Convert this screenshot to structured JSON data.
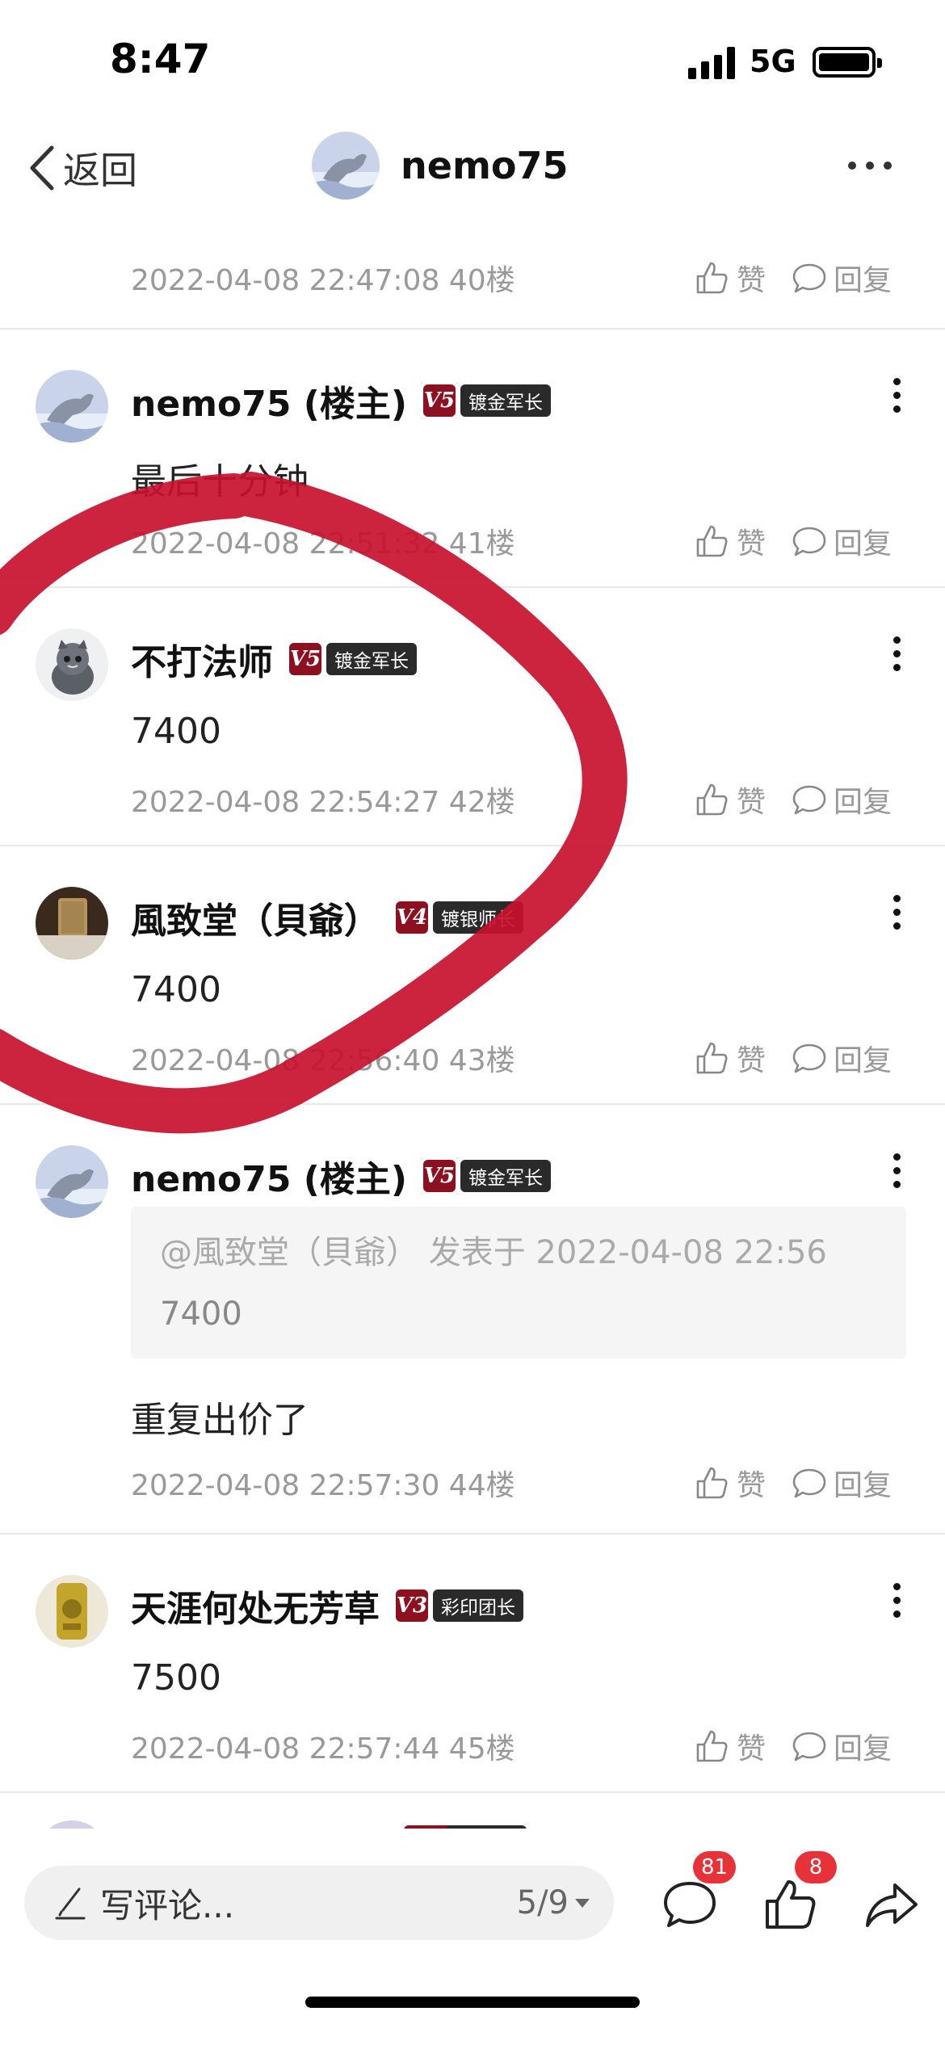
{
  "status_bar": {
    "time": "8:47",
    "network": "5G"
  },
  "nav": {
    "back_label": "返回",
    "title": "nemo75"
  },
  "posts": [
    {
      "meta": "2022-04-08 22:47:08  40楼",
      "like_label": "赞",
      "reply_label": "回复"
    },
    {
      "author": "nemo75 (楼主)",
      "level": "V5",
      "title_badge": "镀金军长",
      "content": "最后十分钟",
      "meta": "2022-04-08 22:51:32  41楼",
      "like_label": "赞",
      "reply_label": "回复"
    },
    {
      "author": "不打法师",
      "level": "V5",
      "title_badge": "镀金军长",
      "content": "7400",
      "meta": "2022-04-08 22:54:27  42楼",
      "like_label": "赞",
      "reply_label": "回复"
    },
    {
      "author": "風致堂（貝爺）",
      "level": "V4",
      "title_badge": "镀银师长",
      "content": "7400",
      "meta": "2022-04-08 22:56:40  43楼",
      "like_label": "赞",
      "reply_label": "回复"
    },
    {
      "author": "nemo75 (楼主)",
      "level": "V5",
      "title_badge": "镀金军长",
      "quote_meta": "@風致堂（貝爺） 发表于 2022-04-08 22:56",
      "quote_text": "7400",
      "content": "重复出价了",
      "meta": "2022-04-08 22:57:30  44楼",
      "like_label": "赞",
      "reply_label": "回复"
    },
    {
      "author": "天涯何处无芳草",
      "level": "V3",
      "title_badge": "彩印团长",
      "content": "7500",
      "meta": "2022-04-08 22:57:44  45楼",
      "like_label": "赞",
      "reply_label": "回复"
    }
  ],
  "bottom_bar": {
    "placeholder": "写评论...",
    "page": "5/9",
    "comment_count": "81",
    "like_count": "8"
  },
  "colors": {
    "accent": "#e8323a",
    "badge_level": "#8c1020",
    "annotation": "#c8102e"
  }
}
